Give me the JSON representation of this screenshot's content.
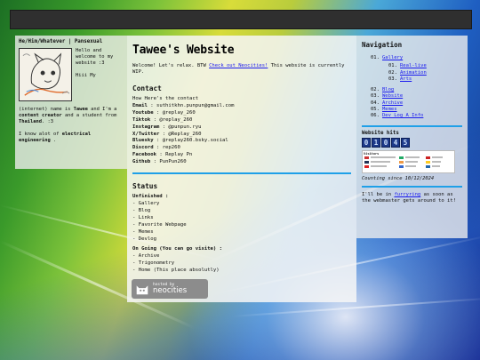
{
  "left": {
    "pronouns": "He/Him/Whatever | Pansexual",
    "hello": "Hello and welcome to my website :3",
    "hiii": "Hiii My",
    "bio_prefix": "(internet) name is",
    "bio_name": "Tawee",
    "bio_mid": "and I'm a",
    "bio_role": "content creator",
    "bio_and": "and a student from",
    "bio_country": "Thailand",
    "bio_end": ". :3",
    "know_prefix": "I know alot of",
    "know_topic": "electrical engineering",
    "know_end": "."
  },
  "main": {
    "title": "Tawee's Website",
    "welcome_pre": "Welcome! Let's relax. BTW",
    "welcome_link": "Check out Neocities!",
    "welcome_post": "This website is currently WIP.",
    "contact_heading": "Contact",
    "contact_intro": "How Here's the contact",
    "contacts": [
      {
        "label": "Email",
        "value": ": suthitkhn.punpun@gmail.com"
      },
      {
        "label": "Youtube",
        "value": ": @replay_260"
      },
      {
        "label": "Tiktok",
        "value": ": @replay_260"
      },
      {
        "label": "Instagram",
        "value": ": @punpun.ryu"
      },
      {
        "label": "X/Twitter",
        "value": ": @Replay_260"
      },
      {
        "label": "Bluesky",
        "value": ": @replay260.bsky.social"
      },
      {
        "label": "Discord",
        "value": ": rep260"
      },
      {
        "label": "Facebook",
        "value": ": Replay Pn"
      },
      {
        "label": "Github",
        "value": ": PunPun260"
      }
    ],
    "status_heading": "Status",
    "unfinished_label": "Unfinished :",
    "unfinished": [
      "- Gallery",
      "- Blog",
      "- Links",
      "- Favorite Webpage",
      "- Memes",
      "- Devlog"
    ],
    "ongoing_label": "On Going (You can go visite) :",
    "ongoing": [
      "- Archive",
      "- Trigonometry",
      "- Home (This place absolutly)"
    ],
    "badge_small": "hosted by",
    "badge_big": "neocities"
  },
  "right": {
    "nav_title": "Navigation",
    "nav": [
      {
        "num": "01.",
        "label": "Gallery"
      },
      {
        "num": "02.",
        "label": "Blog"
      },
      {
        "num": "03.",
        "label": "Website"
      },
      {
        "num": "04.",
        "label": "Archive"
      },
      {
        "num": "05.",
        "label": "Memes"
      },
      {
        "num": "06.",
        "label": "Dev Log A Info"
      }
    ],
    "nav_sub": [
      {
        "num": "01.",
        "label": "Real-live"
      },
      {
        "num": "02.",
        "label": "Animation"
      },
      {
        "num": "03.",
        "label": "Arts"
      }
    ],
    "hits_title": "Website hits",
    "hits_digits": [
      "0",
      "1",
      "0",
      "4",
      "5"
    ],
    "visitors_title": "Visitors",
    "counting": "Counting since 10/12/2024",
    "furry_pre": "I'll be in",
    "furry_link": "furryring",
    "furry_post": "as soon as the webmaster gets around to it!"
  },
  "colors": {
    "link": "#1a1aee",
    "divider": "#1fa0e8",
    "topbar": "#2f2f2f"
  }
}
